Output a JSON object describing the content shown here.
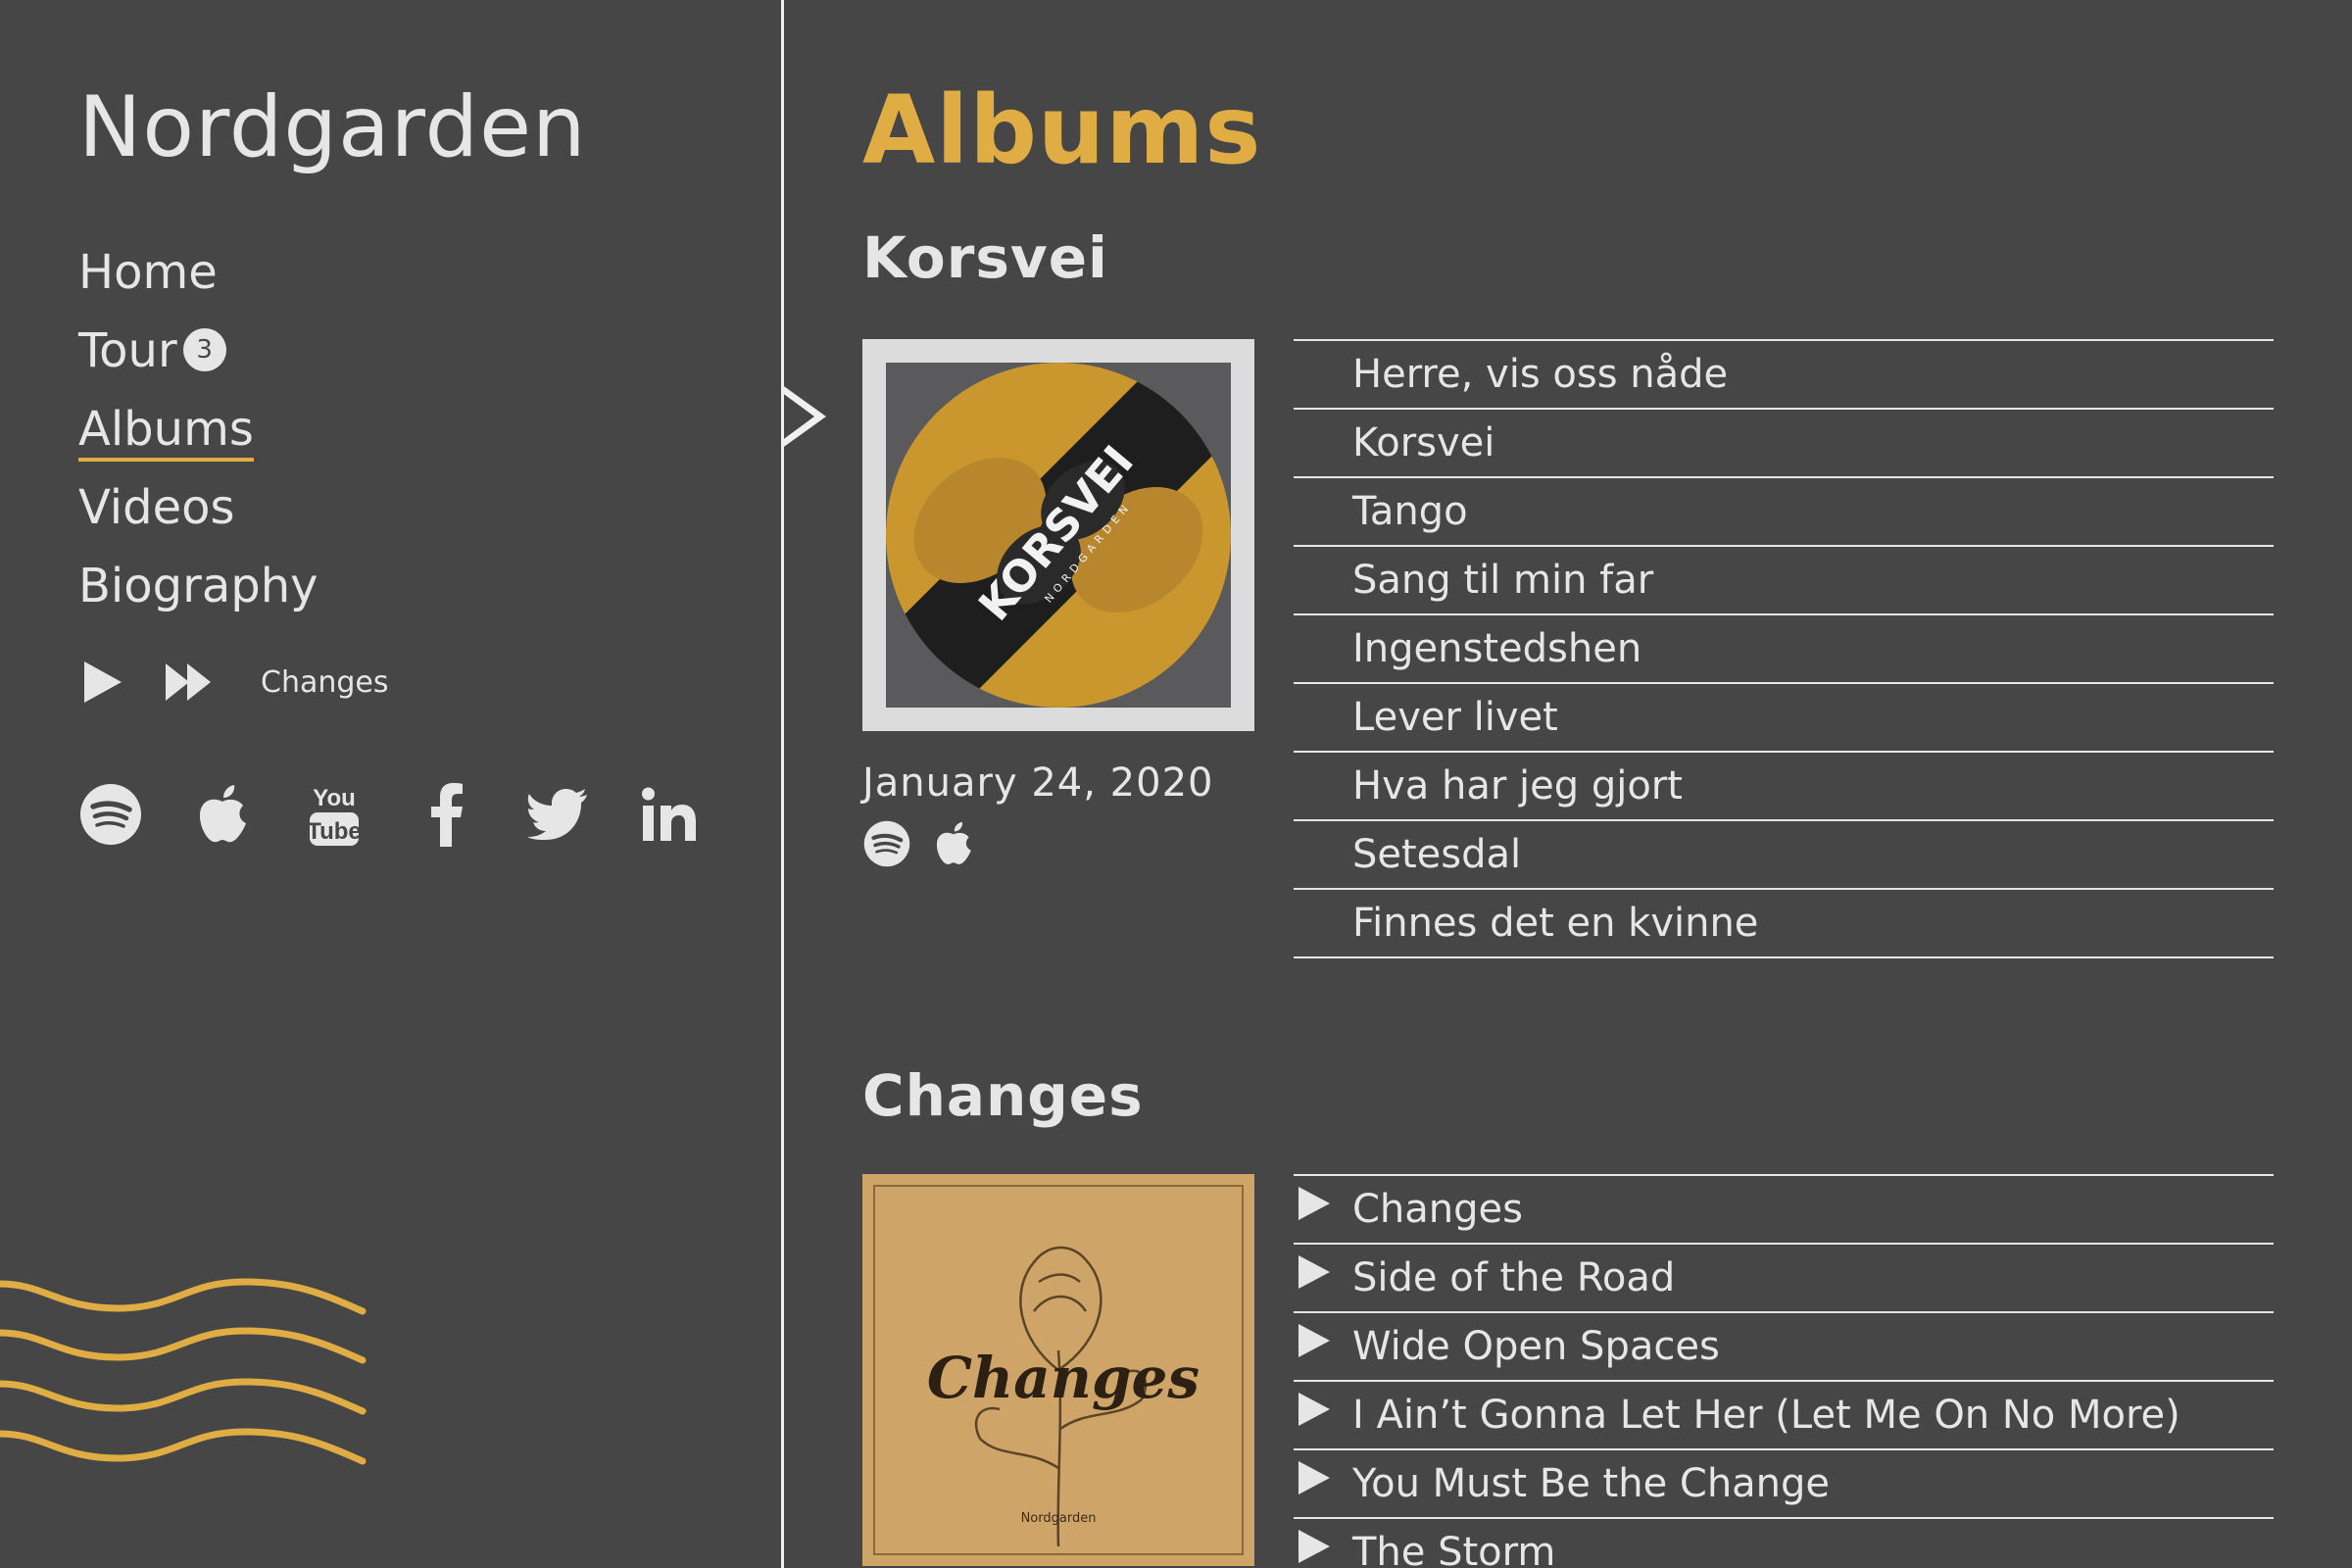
{
  "site": {
    "title": "Nordgarden"
  },
  "nav": {
    "items": [
      {
        "label": "Home"
      },
      {
        "label": "Tour",
        "badge": "3"
      },
      {
        "label": "Albums",
        "active": true
      },
      {
        "label": "Videos"
      },
      {
        "label": "Biography"
      }
    ]
  },
  "player": {
    "now_playing": "Changes",
    "icons": [
      "play-icon",
      "fast-forward-icon"
    ]
  },
  "social": {
    "icons": [
      "spotify-icon",
      "apple-icon",
      "youtube-icon",
      "facebook-icon",
      "twitter-icon",
      "linkedin-icon"
    ]
  },
  "colors": {
    "background": "#464646",
    "accent": "#e0ad44",
    "text": "#e6e6e6"
  },
  "main": {
    "title": "Albums",
    "albums": [
      {
        "title": "Korsvei",
        "cover_text": "KORSVEI",
        "cover_subtext": "NORDGARDEN",
        "date": "January 24, 2020",
        "links": [
          "spotify-icon",
          "apple-icon"
        ],
        "tracks": [
          "Herre, vis oss nåde",
          "Korsvei",
          "Tango",
          "Sang til min far",
          "Ingenstedshen",
          "Lever livet",
          "Hva har jeg gjort",
          "Setesdal",
          "Finnes det en kvinne"
        ]
      },
      {
        "title": "Changes",
        "cover_text": "Changes",
        "cover_subtext": "Nordgarden",
        "tracks": [
          "Changes",
          "Side of the Road",
          "Wide Open Spaces",
          "I Ain’t Gonna Let Her (Let Me On No More)",
          "You Must Be the Change",
          "The Storm"
        ]
      }
    ]
  }
}
